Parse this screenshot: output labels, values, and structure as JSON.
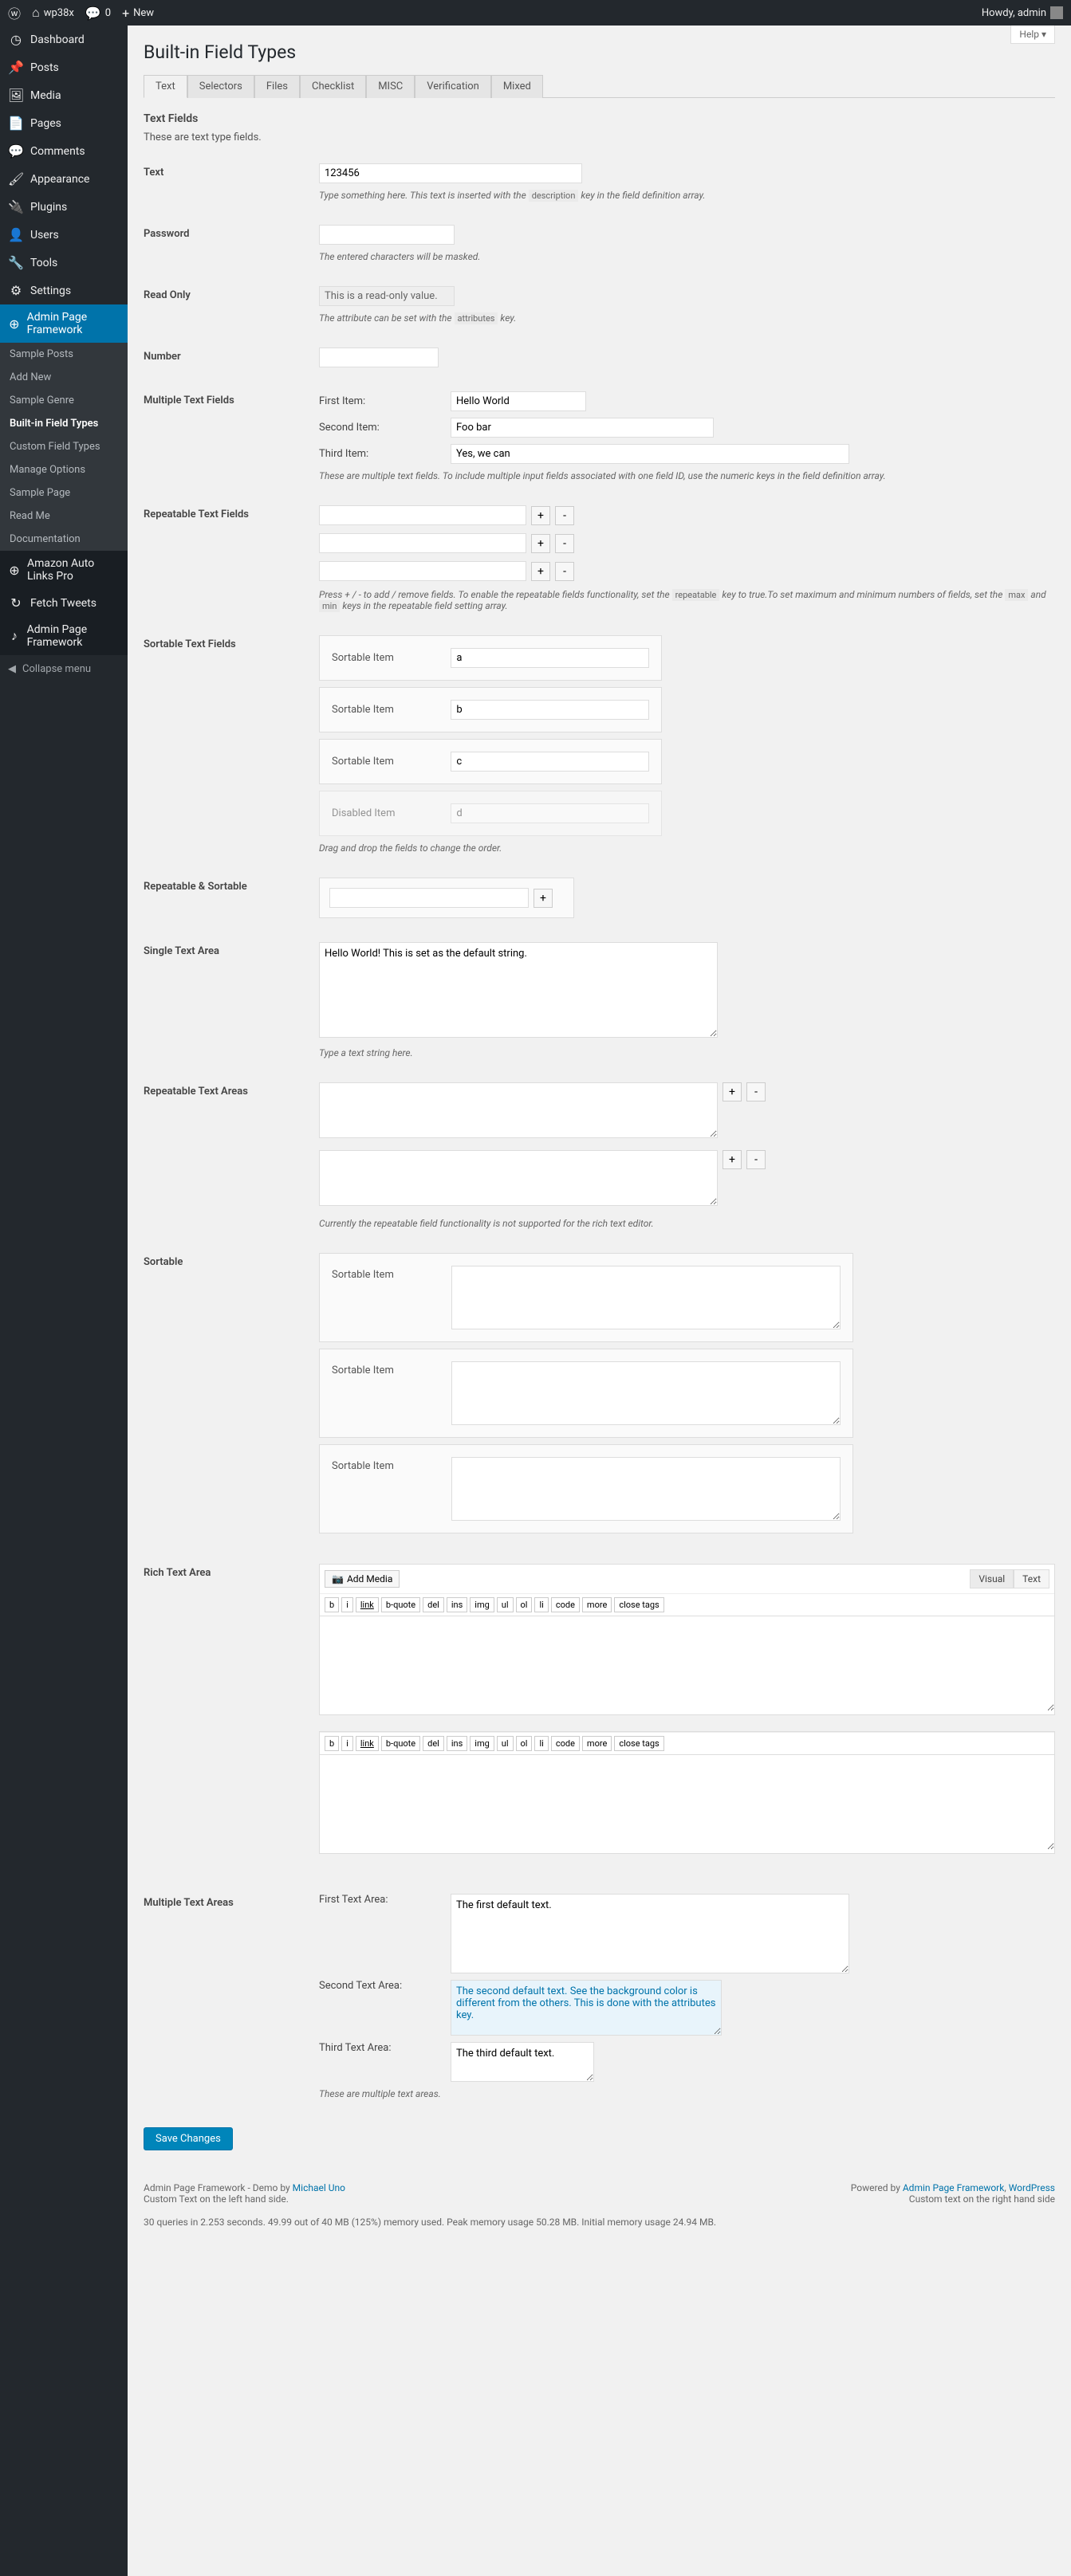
{
  "adminbar": {
    "site": "wp38x",
    "comments": "0",
    "new": "New",
    "howdy": "Howdy, admin"
  },
  "sidebar": {
    "items": [
      {
        "icon": "◷",
        "label": "Dashboard"
      },
      {
        "icon": "📌",
        "label": "Posts"
      },
      {
        "icon": "🖼",
        "label": "Media"
      },
      {
        "icon": "📄",
        "label": "Pages"
      },
      {
        "icon": "💬",
        "label": "Comments"
      },
      {
        "icon": "🖌",
        "label": "Appearance"
      },
      {
        "icon": "🔌",
        "label": "Plugins"
      },
      {
        "icon": "👤",
        "label": "Users"
      },
      {
        "icon": "🔧",
        "label": "Tools"
      },
      {
        "icon": "⚙",
        "label": "Settings"
      },
      {
        "icon": "⊕",
        "label": "Admin Page Framework"
      },
      {
        "icon": "⊕",
        "label": "Amazon Auto Links Pro"
      },
      {
        "icon": "↻",
        "label": "Fetch Tweets"
      },
      {
        "icon": "♪",
        "label": "Admin Page Framework"
      }
    ],
    "submenu": [
      "Sample Posts",
      "Add New",
      "Sample Genre",
      "Built-in Field Types",
      "Custom Field Types",
      "Manage Options",
      "Sample Page",
      "Read Me",
      "Documentation"
    ],
    "collapse": "Collapse menu"
  },
  "help": "Help ▾",
  "page_title": "Built-in Field Types",
  "tabs": [
    "Text",
    "Selectors",
    "Files",
    "Checklist",
    "MISC",
    "Verification",
    "Mixed"
  ],
  "section": {
    "title": "Text Fields",
    "desc": "These are text type fields."
  },
  "fields": {
    "text": {
      "label": "Text",
      "value": "123456",
      "desc_a": "Type something here. This text is inserted with the ",
      "desc_code": "description",
      "desc_b": " key in the field definition array."
    },
    "password": {
      "label": "Password",
      "desc": "The entered characters will be masked."
    },
    "readonly": {
      "label": "Read Only",
      "value": "This is a read-only value.",
      "desc_a": "The attribute can be set with the ",
      "desc_code": "attributes",
      "desc_b": " key."
    },
    "number": {
      "label": "Number"
    },
    "multi": {
      "label": "Multiple Text Fields",
      "items": [
        {
          "label": "First Item:",
          "value": "Hello World"
        },
        {
          "label": "Second Item:",
          "value": "Foo bar"
        },
        {
          "label": "Third Item:",
          "value": "Yes, we can"
        }
      ],
      "desc": "These are multiple text fields. To include multiple input fields associated with one field ID, use the numeric keys in the field definition array."
    },
    "rep": {
      "label": "Repeatable Text Fields",
      "desc_a": "Press + / - to add / remove fields. To enable the repeatable fields functionality, set the ",
      "desc_c1": "repeatable",
      "desc_b": " key to true.To set maximum and minimum numbers of fields, set the ",
      "desc_c2": "max",
      "desc_c": " and ",
      "desc_c3": "min",
      "desc_d": " keys in the repeatable field setting array."
    },
    "sort": {
      "label": "Sortable Text Fields",
      "items": [
        {
          "label": "Sortable Item",
          "value": "a"
        },
        {
          "label": "Sortable Item",
          "value": "b"
        },
        {
          "label": "Sortable Item",
          "value": "c"
        },
        {
          "label": "Disabled Item",
          "value": "d",
          "disabled": true
        }
      ],
      "desc": "Drag and drop the fields to change the order."
    },
    "repsort": {
      "label": "Repeatable & Sortable"
    },
    "single_ta": {
      "label": "Single Text Area",
      "value": "Hello World! This is set as the default string.",
      "desc": "Type a text string here."
    },
    "rep_ta": {
      "label": "Repeatable Text Areas",
      "desc": "Currently the repeatable field functionality is not supported for the rich text editor."
    },
    "sort_ta": {
      "label": "Sortable",
      "items": [
        "Sortable Item",
        "Sortable Item",
        "Sortable Item"
      ]
    },
    "rich": {
      "label": "Rich Text Area",
      "media": "Add Media",
      "visual": "Visual",
      "text": "Text",
      "buttons": [
        "b",
        "i",
        "link",
        "b-quote",
        "del",
        "ins",
        "img",
        "ul",
        "ol",
        "li",
        "code",
        "more",
        "close tags"
      ]
    },
    "multi_ta": {
      "label": "Multiple Text Areas",
      "items": [
        {
          "label": "First Text Area:",
          "value": "The first default text."
        },
        {
          "label": "Second Text Area:",
          "value": "The second default text. See the background color is different from the others. This is done with the attributes key."
        },
        {
          "label": "Third Text Area:",
          "value": "The third default text."
        }
      ],
      "desc": "These are multiple text areas."
    }
  },
  "submit": "Save Changes",
  "footer": {
    "left_a": "Admin Page Framework - Demo by ",
    "left_link": "Michael Uno",
    "left_b": "Custom Text on the left hand side.",
    "right_a": "Powered by ",
    "right_link1": "Admin Page Framework",
    "right_sep": ", ",
    "right_link2": "WordPress",
    "right_b": "Custom text on the right hand side"
  },
  "stats": "30 queries in 2.253 seconds.    49.99 out of 40 MB (125%) memory used.    Peak memory usage 50.28 MB.    Initial memory usage 24.94 MB."
}
